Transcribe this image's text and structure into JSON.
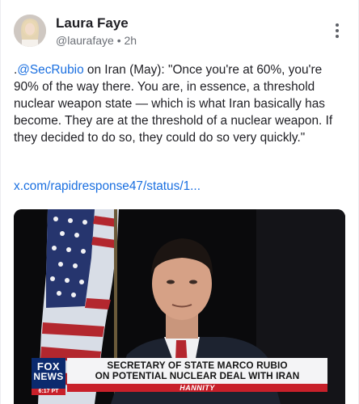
{
  "post": {
    "author_name": "Laura Faye",
    "handle": "@laurafaye",
    "separator": "•",
    "time_ago": "2h",
    "text_prefix": ".",
    "mention": "@SecRubio",
    "text_body": " on Iran (May): \"Once you're at 60%, you're 90% of the way there. You are, in essence, a threshold nuclear weapon state — which is what Iran basically has become. They are at the threshold of a nuclear weapon. If they decided to do so, they could do so very quickly.\"",
    "link_text": "x.com/rapidresponse47/status/1..."
  },
  "video": {
    "caption_line1": "SECRETARY OF STATE MARCO RUBIO",
    "caption_line2": "ON POTENTIAL NUCLEAR DEAL WITH IRAN",
    "show_name": "HANNITY",
    "logo_line1": "FOX",
    "logo_line2": "NEWS",
    "logo_time": "6:17 PT"
  },
  "colors": {
    "link": "#1a6fe0",
    "text": "#1f1f24",
    "muted": "#6b6f76",
    "chyron_red": "#c8202a",
    "fox_blue": "#0b2a6e"
  },
  "icons": [
    "avatar",
    "more-vertical-icon"
  ]
}
